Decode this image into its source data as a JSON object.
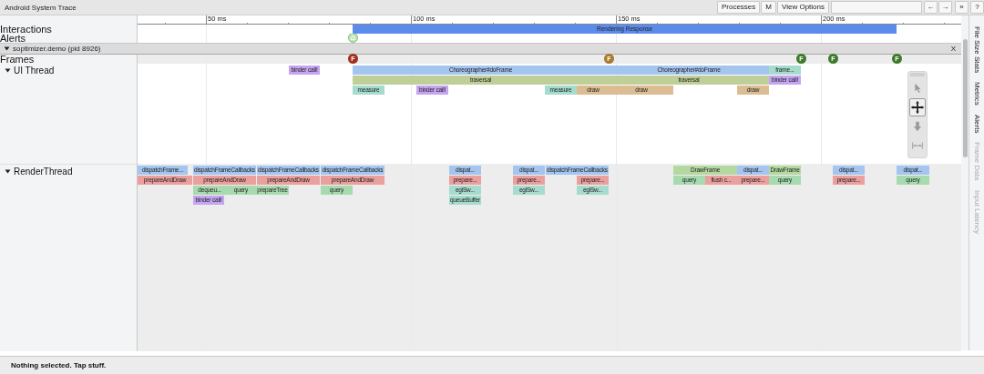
{
  "title": "Android System Trace",
  "toolbar": {
    "buttons": [
      "Processes",
      "M",
      "View Options"
    ],
    "nav_buttons": [
      "←",
      "→",
      "»",
      "?"
    ]
  },
  "ruler": {
    "ticks": [
      "50 ms",
      "100 ms",
      "150 ms",
      "200 ms"
    ]
  },
  "interactions": {
    "label": "Interactions",
    "slices": [
      {
        "name": "Rendering Response",
        "color": "#5b8cec"
      }
    ]
  },
  "alerts": {
    "label": "Alerts"
  },
  "process": {
    "title": "soptimizer.demo (pid 8926)",
    "expanded": true,
    "close": "X"
  },
  "frames": {
    "label": "Frames",
    "markers": [
      {
        "label": "F",
        "color": "#a3301f"
      },
      {
        "label": "F",
        "color": "#a97a2f"
      },
      {
        "label": "F",
        "color": "#3f7a2c"
      },
      {
        "label": "F",
        "color": "#3f7a2c"
      },
      {
        "label": "F",
        "color": "#3f7a2c"
      }
    ]
  },
  "threads": [
    {
      "name": "UI Thread",
      "expanded": true,
      "lanes": [
        {
          "slices": [
            {
              "name": "binder call!",
              "color": "#c5a5f1"
            },
            {
              "name": "Choreographer#doFrame",
              "color": "#a3c5f0"
            },
            {
              "name": "Choreographer#doFrame",
              "color": "#a3c5f0"
            },
            {
              "name": "frame...",
              "color": "#a6dccd"
            }
          ]
        },
        {
          "slices": [
            {
              "name": "traversal",
              "color": "#bfcf98"
            },
            {
              "name": "traversal",
              "color": "#bfcf98"
            },
            {
              "name": "binder call!",
              "color": "#c5a5f1"
            }
          ]
        },
        {
          "slices": [
            {
              "name": "measure",
              "color": "#a6dccd"
            },
            {
              "name": "binder call!",
              "color": "#c5a5f1"
            },
            {
              "name": "measure",
              "color": "#a6dccd"
            },
            {
              "name": "draw",
              "color": "#dbbc93"
            },
            {
              "name": "draw",
              "color": "#dbbc93"
            },
            {
              "name": "draw",
              "color": "#dbbc93"
            }
          ]
        }
      ]
    },
    {
      "name": "RenderThread",
      "expanded": true,
      "lanes": [
        {
          "slices": [
            {
              "name": "dispatchFrame...",
              "color": "#a3c5f0"
            },
            {
              "name": "dispatchFrameCallbacks",
              "color": "#a3c5f0"
            },
            {
              "name": "dispatchFrameCallbacks",
              "color": "#a3c5f0"
            },
            {
              "name": "dispatchFrameCallbacks",
              "color": "#a3c5f0"
            },
            {
              "name": "dispat...",
              "color": "#a3c5f0"
            },
            {
              "name": "dispat...",
              "color": "#a3c5f0"
            },
            {
              "name": "dispatchFrameCallbacks",
              "color": "#a3c5f0"
            },
            {
              "name": "DrawFrame",
              "color": "#b3d99e"
            },
            {
              "name": "dispat...",
              "color": "#a3c5f0"
            },
            {
              "name": "DrawFrame",
              "color": "#b3d99e"
            },
            {
              "name": "dispat...",
              "color": "#a3c5f0"
            },
            {
              "name": "dispat...",
              "color": "#a3c5f0"
            }
          ]
        },
        {
          "slices": [
            {
              "name": "prepareAndDraw",
              "color": "#eba09e"
            },
            {
              "name": "prepareAndDraw",
              "color": "#eba09e"
            },
            {
              "name": "prepareAndDraw",
              "color": "#eba09e"
            },
            {
              "name": "prepareAndDraw",
              "color": "#eba09e"
            },
            {
              "name": "prepare...",
              "color": "#eba09e"
            },
            {
              "name": "prepare...",
              "color": "#eba09e"
            },
            {
              "name": "prepare...",
              "color": "#eba09e"
            },
            {
              "name": "query",
              "color": "#a8dab0"
            },
            {
              "name": "flush c...",
              "color": "#eba09e"
            },
            {
              "name": "prepare...",
              "color": "#eba09e"
            },
            {
              "name": "query",
              "color": "#a8dab0"
            },
            {
              "name": "prepare...",
              "color": "#eba09e"
            },
            {
              "name": "query",
              "color": "#a8dab0"
            }
          ]
        },
        {
          "slices": [
            {
              "name": "dequeu...",
              "color": "#a8dab0"
            },
            {
              "name": "query",
              "color": "#a8dab0"
            },
            {
              "name": "prepareTree",
              "color": "#a8dab0"
            },
            {
              "name": "query",
              "color": "#a8dab0"
            },
            {
              "name": "eglSw...",
              "color": "#a6dccd"
            },
            {
              "name": "eglSw...",
              "color": "#a6dccd"
            },
            {
              "name": "eglSw...",
              "color": "#a6dccd"
            }
          ]
        },
        {
          "slices": [
            {
              "name": "binder call!",
              "color": "#c5a5f1"
            },
            {
              "name": "queueBuffer",
              "color": "#a6dccd"
            }
          ]
        }
      ]
    }
  ],
  "tools": [
    {
      "kind": "select",
      "selected": false
    },
    {
      "kind": "pan",
      "selected": true
    },
    {
      "kind": "zoom",
      "selected": false
    },
    {
      "kind": "timing",
      "selected": false
    }
  ],
  "side_tabs": [
    {
      "label": "File Size Stats",
      "disabled": false
    },
    {
      "label": "Metrics",
      "disabled": false
    },
    {
      "label": "Alerts",
      "disabled": false
    },
    {
      "label": "Frame Data",
      "disabled": true
    },
    {
      "label": "Input Latency",
      "disabled": true
    }
  ],
  "status": "Nothing selected. Tap stuff."
}
